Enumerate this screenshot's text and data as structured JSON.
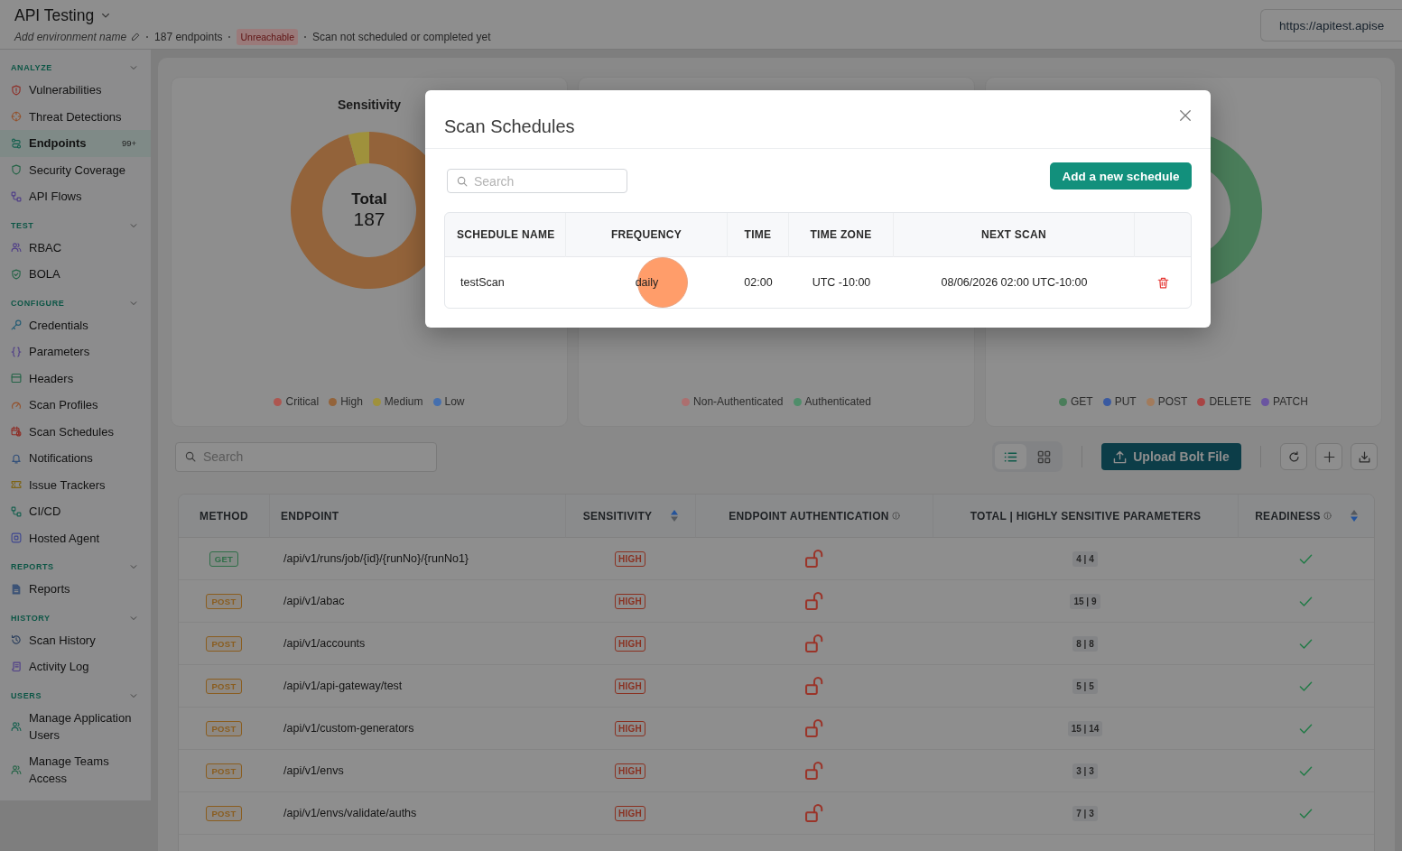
{
  "header": {
    "title": "API Testing",
    "environment_placeholder": "Add environment name",
    "endpoint_count": "187 endpoints",
    "status_badge": "Unreachable",
    "scan_status": "Scan not scheduled or completed yet",
    "url": "https://apitest.apise"
  },
  "sidebar": {
    "sections": [
      {
        "title": "ANALYZE",
        "expanded": true,
        "items": [
          {
            "label": "Vulnerabilities",
            "selected": false
          },
          {
            "label": "Threat Detections",
            "selected": false
          },
          {
            "label": "Endpoints",
            "selected": true,
            "count": "99+"
          },
          {
            "label": "Security Coverage",
            "selected": false
          },
          {
            "label": "API Flows",
            "selected": false
          }
        ]
      },
      {
        "title": "TEST",
        "expanded": true,
        "items": [
          {
            "label": "RBAC",
            "selected": false
          },
          {
            "label": "BOLA",
            "selected": false
          }
        ]
      },
      {
        "title": "CONFIGURE",
        "expanded": true,
        "items": [
          {
            "label": "Credentials",
            "selected": false
          },
          {
            "label": "Parameters",
            "selected": false
          },
          {
            "label": "Headers",
            "selected": false
          },
          {
            "label": "Scan Profiles",
            "selected": false
          },
          {
            "label": "Scan Schedules",
            "selected": false
          },
          {
            "label": "Notifications",
            "selected": false
          },
          {
            "label": "Issue Trackers",
            "selected": false
          },
          {
            "label": "CI/CD",
            "selected": false
          },
          {
            "label": "Hosted Agent",
            "selected": false
          }
        ]
      },
      {
        "title": "REPORTS",
        "expanded": true,
        "items": [
          {
            "label": "Reports",
            "selected": false
          }
        ]
      },
      {
        "title": "HISTORY",
        "expanded": true,
        "items": [
          {
            "label": "Scan History",
            "selected": false
          },
          {
            "label": "Activity Log",
            "selected": false
          }
        ]
      },
      {
        "title": "USERS",
        "expanded": true,
        "items": [
          {
            "label": "Manage Application Users",
            "selected": false
          },
          {
            "label": "Manage Teams Access",
            "selected": false
          }
        ]
      }
    ]
  },
  "charts": [
    {
      "center_label": "Total",
      "center_value": "187",
      "chart_data": {
        "type": "donut",
        "title": "Sensitivity",
        "categories": [
          "Critical",
          "High",
          "Medium",
          "Low"
        ],
        "values": [
          0,
          95.7,
          4.3,
          0
        ],
        "colors": [
          "#ad5650",
          "#93633a",
          "#9f913c",
          "#456fae"
        ]
      }
    },
    {
      "legend": [
        {
          "label": "Non-Authenticated",
          "color": "#ac6f6f"
        },
        {
          "label": "Authenticated",
          "color": "#4f8d6a"
        }
      ]
    },
    {
      "donut_visible": true,
      "legend": [
        {
          "label": "GET",
          "color": "#4a7d5a"
        },
        {
          "label": "PUT",
          "color": "#3a5aa0"
        },
        {
          "label": "POST",
          "color": "#a27b5c"
        },
        {
          "label": "DELETE",
          "color": "#a84444"
        },
        {
          "label": "PATCH",
          "color": "#6a55a0"
        }
      ]
    }
  ],
  "toolbar": {
    "search_placeholder": "Search",
    "view_modes": [
      {
        "kind": "list",
        "selected": true
      },
      {
        "kind": "grid",
        "selected": false
      }
    ],
    "upload_button": "Upload Bolt File",
    "actions": [
      {
        "kind": "refresh"
      },
      {
        "kind": "add"
      },
      {
        "kind": "download"
      }
    ]
  },
  "endpoints": {
    "columns": [
      {
        "label": "METHOD",
        "info": false,
        "sortable": false
      },
      {
        "label": "ENDPOINT",
        "info": false,
        "sortable": false
      },
      {
        "label": "SENSITIVITY",
        "info": false,
        "sortable": true,
        "ascending": true
      },
      {
        "label": "ENDPOINT AUTHENTICATION",
        "info": true,
        "sortable": false
      },
      {
        "label": "TOTAL | HIGHLY SENSITIVE PARAMETERS",
        "info": false,
        "sortable": false
      },
      {
        "label": "READINESS",
        "info": true,
        "sortable": true,
        "ascending": false
      }
    ],
    "rows": [
      {
        "method": {
          "label": "GET",
          "color": "#2f6e48"
        },
        "endpoint": "/api/v1/runs/job/{id}/{runNo}/{runNo1}",
        "sensitivity": "HIGH",
        "authenticated": false,
        "parameters": "4 | 4",
        "ready": true
      },
      {
        "method": {
          "label": "POST",
          "color": "#8a5d1f"
        },
        "endpoint": "/api/v1/abac",
        "sensitivity": "HIGH",
        "authenticated": false,
        "parameters": "15 | 9",
        "ready": true
      },
      {
        "method": {
          "label": "POST",
          "color": "#8a5d1f"
        },
        "endpoint": "/api/v1/accounts",
        "sensitivity": "HIGH",
        "authenticated": false,
        "parameters": "8 | 8",
        "ready": true
      },
      {
        "method": {
          "label": "POST",
          "color": "#8a5d1f"
        },
        "endpoint": "/api/v1/api-gateway/test",
        "sensitivity": "HIGH",
        "authenticated": false,
        "parameters": "5 | 5",
        "ready": true
      },
      {
        "method": {
          "label": "POST",
          "color": "#8a5d1f"
        },
        "endpoint": "/api/v1/custom-generators",
        "sensitivity": "HIGH",
        "authenticated": false,
        "parameters": "15 | 14",
        "ready": true
      },
      {
        "method": {
          "label": "POST",
          "color": "#8a5d1f"
        },
        "endpoint": "/api/v1/envs",
        "sensitivity": "HIGH",
        "authenticated": false,
        "parameters": "3 | 3",
        "ready": true
      },
      {
        "method": {
          "label": "POST",
          "color": "#8a5d1f"
        },
        "endpoint": "/api/v1/envs/validate/auths",
        "sensitivity": "HIGH",
        "authenticated": false,
        "parameters": "7 | 3",
        "ready": true
      }
    ]
  },
  "modal": {
    "title": "Scan Schedules",
    "search_placeholder": "Search",
    "add_button": "Add a new schedule",
    "columns": [
      "SCHEDULE NAME",
      "FREQUENCY",
      "TIME",
      "TIME ZONE",
      "NEXT SCAN"
    ],
    "rows": [
      {
        "name": "testScan",
        "frequency": "daily",
        "time": "02:00",
        "time_zone": "UTC -10:00",
        "next_scan": "08/06/2026 02:00 UTC-10:00",
        "click_marker": true
      }
    ]
  }
}
